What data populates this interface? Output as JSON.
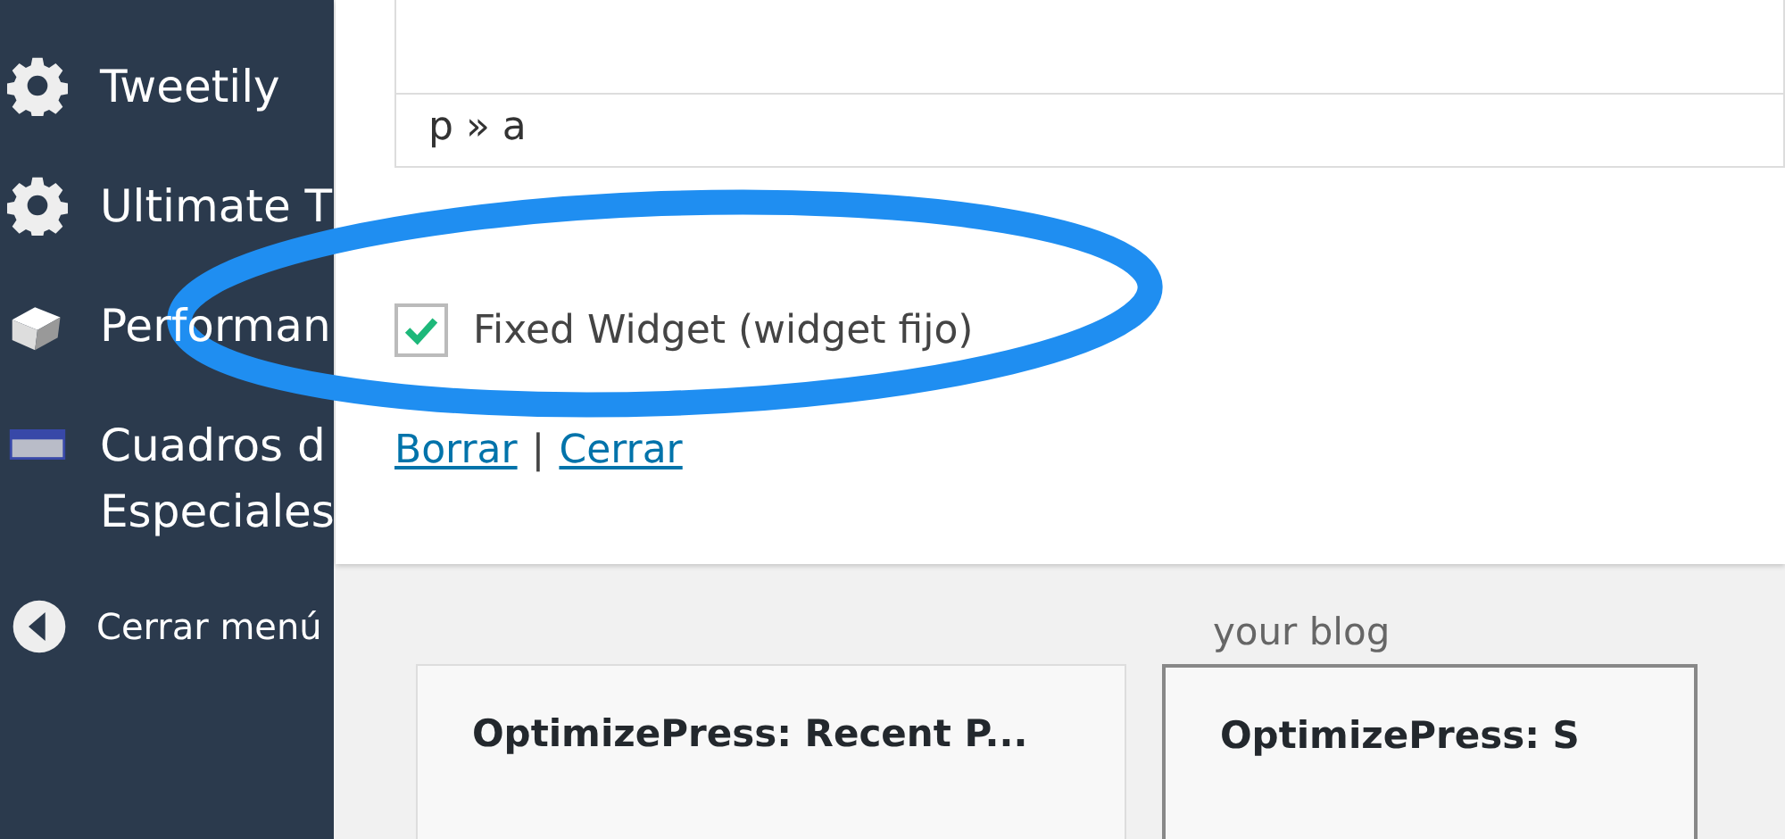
{
  "sidebar": {
    "items": [
      {
        "kind": "gear",
        "label": "Tweetily"
      },
      {
        "kind": "gear",
        "label": "Ultimate T"
      },
      {
        "kind": "cube",
        "label": "Performan"
      },
      {
        "kind": "card",
        "label": "Cuadros d",
        "label_2": "Especiales"
      }
    ],
    "collapse": {
      "label": "Cerrar menú"
    }
  },
  "panel": {
    "path": "p » a",
    "checkbox": {
      "label": "Fixed Widget (widget fijo)",
      "checked": true
    },
    "links": [
      "Borrar",
      "Cerrar"
    ],
    "separator": "|"
  },
  "background": {
    "note": "your blog",
    "widgets": [
      {
        "title": "OptimizePress: Recent P...",
        "selected": false
      },
      {
        "title": "OptimizePress: S",
        "selected": true
      }
    ]
  }
}
